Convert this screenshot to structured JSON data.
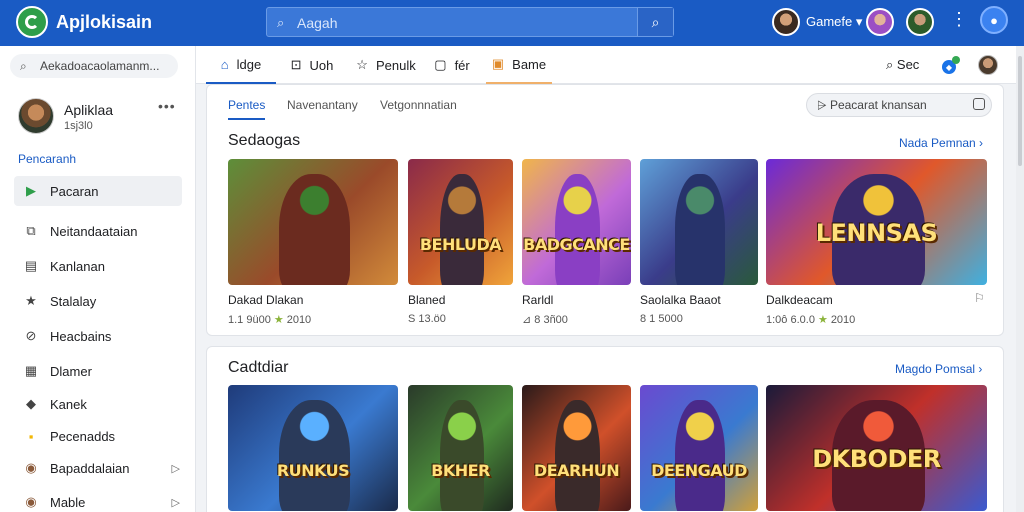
{
  "header": {
    "app_title": "Apjlokisain",
    "search_placeholder": "Aagah",
    "user_name": "Gamefe ▾",
    "colors": {
      "bar": "#1a5bc4",
      "accent": "#1a73e8"
    }
  },
  "sidebar": {
    "search_text": "Aekadoacaolamanm...",
    "profile": {
      "name": "Apliklaa",
      "sub": "1sj3l0",
      "more": "•••"
    },
    "section_label": "Pencaranh",
    "items": [
      {
        "label": "Pacaran",
        "icon": "games-icon",
        "glyph": "▶",
        "active": true
      },
      {
        "label": "Neitandaataian",
        "icon": "tag-icon",
        "glyph": "⧉"
      },
      {
        "label": "Kanlanan",
        "icon": "list-icon",
        "glyph": "▤"
      },
      {
        "label": "Stalalay",
        "icon": "star-icon",
        "glyph": "★"
      },
      {
        "label": "Heacbains",
        "icon": "ban-icon",
        "glyph": "⊘"
      },
      {
        "label": "Dlamer",
        "icon": "document-icon",
        "glyph": "▦"
      },
      {
        "label": "Kanek",
        "icon": "game-icon",
        "glyph": "◆"
      },
      {
        "label": "Pecenadds",
        "icon": "coin-icon",
        "glyph": "▪"
      },
      {
        "label": "Bapaddalaian",
        "icon": "character-icon",
        "glyph": "◉",
        "chevron": "▷"
      },
      {
        "label": "Mable",
        "icon": "hero-icon",
        "glyph": "◉",
        "chevron": "▷"
      }
    ]
  },
  "tabs": [
    {
      "label": "ldge",
      "icon": "home-icon",
      "glyph": "⌂"
    },
    {
      "label": "Uoh",
      "icon": "download-icon",
      "glyph": "⊡"
    },
    {
      "label": "Penulk",
      "icon": "star-outline-icon",
      "glyph": "☆"
    },
    {
      "label": "fér",
      "icon": "square-icon",
      "glyph": "▢"
    },
    {
      "label": "Bame",
      "icon": "game-pad-icon",
      "glyph": "▣"
    }
  ],
  "tabs_right": {
    "search_label": "Sec"
  },
  "subtabs": [
    "Pentes",
    "Navenantany",
    "Vetgonnnatian"
  ],
  "filter_label": "Peacarat knansan",
  "sections": [
    {
      "title": "Sedaogas",
      "more": "Nada Pemnan ›",
      "games": [
        {
          "name": "Dakad Dlakan",
          "meta_a": "1.1 9ü00",
          "star": "★",
          "meta_b": "2010",
          "art": ""
        },
        {
          "name": "Blaned",
          "meta_a": "S 13.ö0",
          "star": "",
          "meta_b": "",
          "art": "BEHLUDA"
        },
        {
          "name": "Rarldl",
          "meta_a": "⊿ 8 3ñ00",
          "star": "",
          "meta_b": "",
          "art": "BADGCANCE"
        },
        {
          "name": "Saolalka Baaot",
          "meta_a": "8 1 5000",
          "star": "",
          "meta_b": "",
          "art": ""
        },
        {
          "name": "Dalkdeacam",
          "meta_a": "1:0ô 6.0.0",
          "star": "★",
          "meta_b": "2010",
          "art": "LENNSAS"
        }
      ]
    },
    {
      "title": "Cadtdiar",
      "more": "Magdo Pomsal ›",
      "games": [
        {
          "name": "",
          "art": "RUNKUS"
        },
        {
          "name": "",
          "art": "BKHER"
        },
        {
          "name": "",
          "art": "DEARHUN"
        },
        {
          "name": "",
          "art": "DEENGAUD"
        },
        {
          "name": "",
          "art": "DKBODER"
        }
      ]
    }
  ]
}
